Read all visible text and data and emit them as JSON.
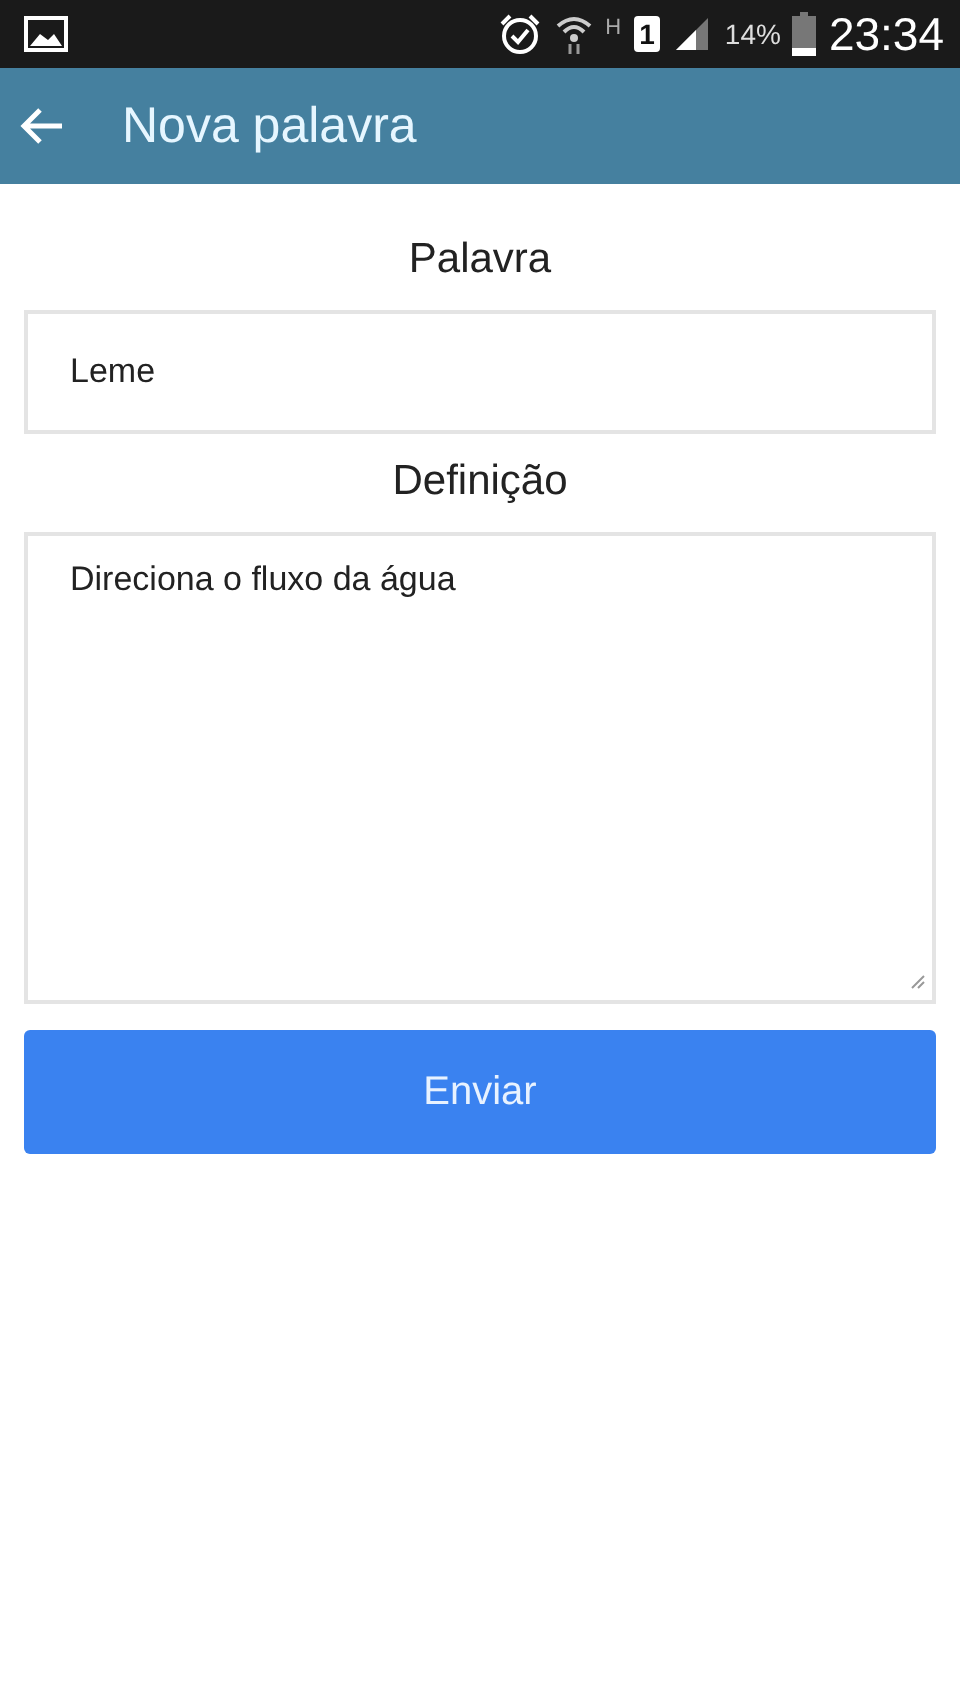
{
  "status_bar": {
    "network_type": "H",
    "sim_slot": "1",
    "battery": "14%",
    "time": "23:34"
  },
  "app_bar": {
    "title": "Nova palavra"
  },
  "form": {
    "fields": [
      {
        "kind": "input",
        "label": "Palavra",
        "value": "Leme"
      },
      {
        "kind": "textarea",
        "label": "Definição",
        "value": "Direciona o fluxo da água"
      }
    ],
    "submit": "Enviar"
  }
}
